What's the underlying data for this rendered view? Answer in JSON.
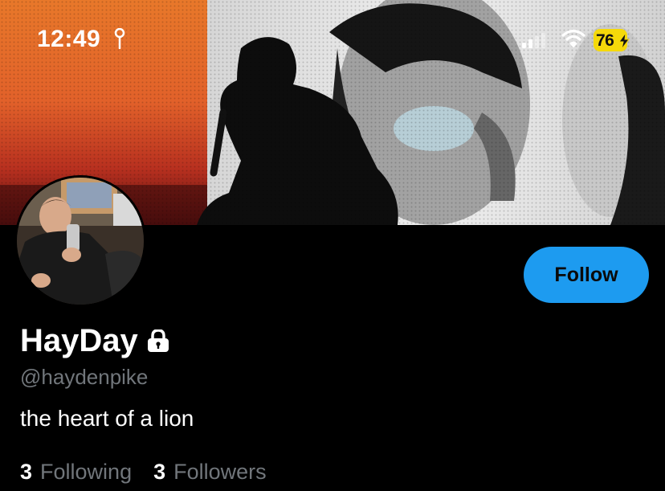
{
  "status_bar": {
    "time": "12:49",
    "battery_percent": "76",
    "icons": [
      "location-icon",
      "signal-icon",
      "wifi-icon",
      "battery-icon",
      "charging-bolt-icon"
    ]
  },
  "profile": {
    "display_name": "HayDay",
    "handle": "@haydenpike",
    "bio": "the heart of a lion",
    "protected_icon": "lock-icon",
    "follow_label": "Follow",
    "following_count": "3",
    "following_label": "Following",
    "followers_count": "3",
    "followers_label": "Followers"
  },
  "colors": {
    "background": "#000000",
    "accent": "#1d9bf0",
    "secondary_text": "#71767b",
    "battery": "#f5d90a"
  }
}
